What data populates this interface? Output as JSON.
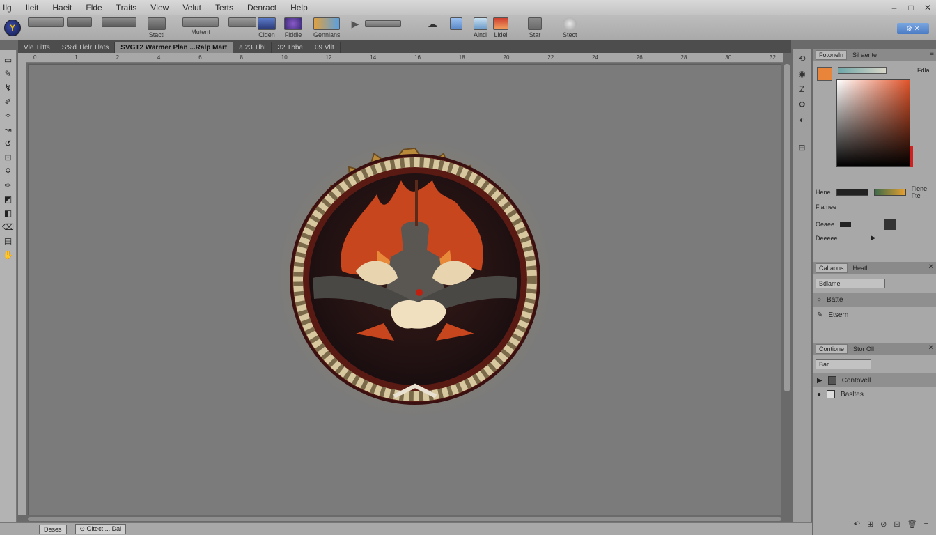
{
  "menu": [
    "Ilg",
    "Ileit",
    "Haeit",
    "Flde",
    "Traits",
    "Vlew",
    "Velut",
    "Terts",
    "Denract",
    "Help"
  ],
  "window_controls": [
    "–",
    "□",
    "✕"
  ],
  "toolbar": {
    "labels": [
      "Stacti",
      "Mutent",
      "Clden",
      "Flddle",
      "Gennlans",
      "Alndi",
      "Lldel",
      "Star",
      "Stect"
    ],
    "right_button": "⚙ ✕"
  },
  "tabs": [
    "Vle Tiltts",
    "S%d Tlelr Tlats",
    "SVGT2 Warmer Plan ...Ralp Mart",
    "a  23 Tlhl",
    "32 Tbbe",
    "09  Vllt"
  ],
  "ruler_ticks": [
    "0",
    "1",
    "2",
    "4",
    "6",
    "8",
    "10",
    "12",
    "14",
    "16",
    "18",
    "20",
    "22",
    "24",
    "26",
    "28",
    "30",
    "32"
  ],
  "status": {
    "field1": "Deses",
    "field2": "⊙ Oltect ... Dal"
  },
  "color_panel": {
    "tabs": [
      "Fotoneln",
      "Sil aente"
    ],
    "swatch_color": "#e9853a",
    "row_labels": [
      "Hene",
      "Fiene Fte",
      "Fiamee",
      "Oeaee",
      "Deeeee"
    ],
    "value_badge": "Fdla"
  },
  "channels_panel": {
    "tabs": [
      "Caltaons",
      "Heatl"
    ],
    "dropdown": "Bdlame",
    "rows": [
      "Batte",
      "Etsern"
    ]
  },
  "layers_panel": {
    "tabs": [
      "Contione",
      "Stor Oll"
    ],
    "dropdown": "Bar",
    "rows": [
      "Contovell",
      "Basltes"
    ]
  },
  "panel_bottom_icons": [
    "↶",
    "⊞",
    "⊘",
    "⊡",
    "🗑",
    "≡"
  ]
}
